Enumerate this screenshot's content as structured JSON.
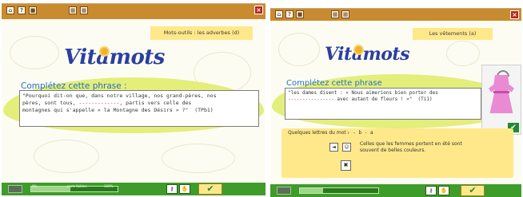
{
  "panel_left": {
    "toolbar_icons": [
      "home-icon",
      "question-icon",
      "grid-icon"
    ],
    "title_tag": "Mots-outils : les adverbes (d)",
    "logo": "Vitamots",
    "prompt": "Complétez cette phrase :",
    "sentence_part1": "\"Pourquoi dit-on que, dans notre village, nos grand-pères, nos\npères, sont tous, ",
    "sentence_blank": "-------------",
    "sentence_part2": ", partis vers celle des\nmontagnes qui s'appelle « la Montagne des Désirs » ?\"  (TPb1)",
    "slider_label_left": "0%",
    "slider_label_mid": "mots faibles",
    "slider_label_right": "100%",
    "progress": 0.45,
    "validate_label": "✔"
  },
  "panel_right": {
    "toolbar_icons": [
      "home-icon",
      "question-icon",
      "grid-icon"
    ],
    "title_tag": "Les vêtements (a)",
    "logo": "Vitamots",
    "prompt": "Complétez cette phrase",
    "sentence_part1": "\"les dames disent : « Nous aimerions bien porter des\n",
    "sentence_blank": "----------------",
    "sentence_part2": " avec autant de fleurs ! »\"  (Ti1)",
    "hint_label": "Quelques lettres du mot :",
    "hint_value": "- - b - a",
    "hint_text": "Celles que les femmes portent en été sont souvent de belles couleurs.",
    "progress": 0.3,
    "validate_label": "✔",
    "image_ok_label": "✔"
  }
}
